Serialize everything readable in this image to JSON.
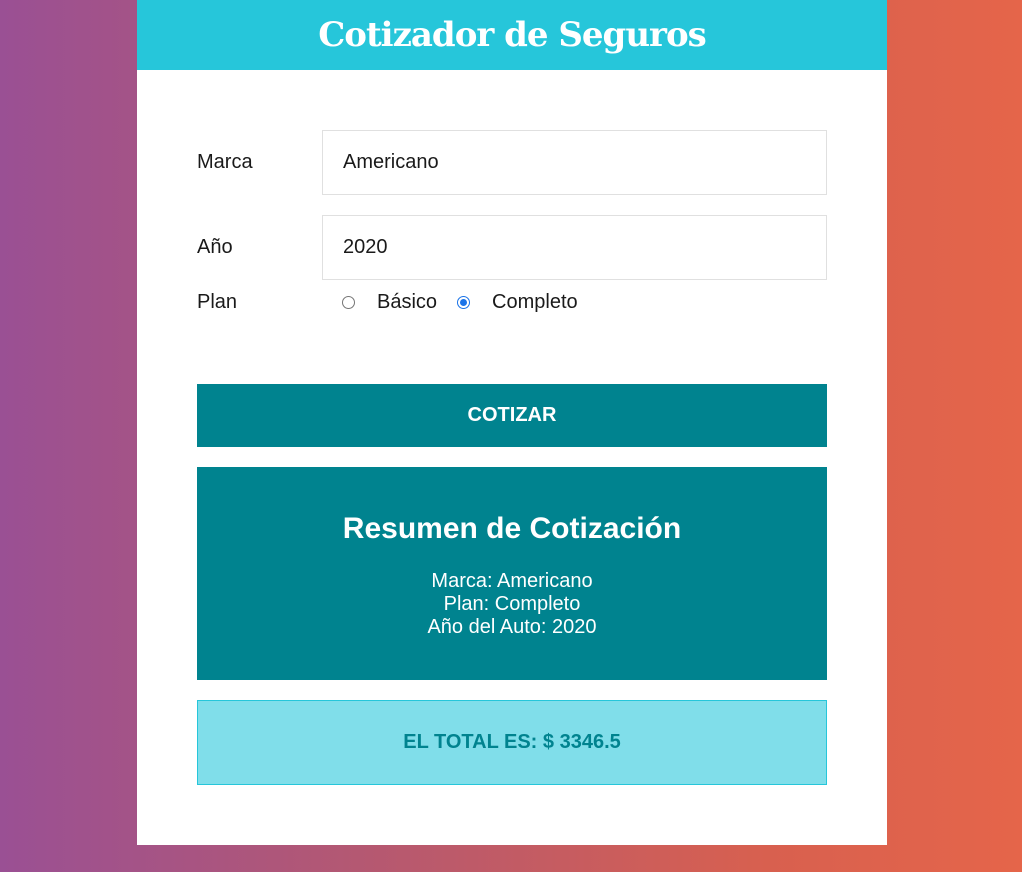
{
  "header": {
    "title": "Cotizador de Seguros"
  },
  "form": {
    "marca": {
      "label": "Marca",
      "value": "Americano"
    },
    "anio": {
      "label": "Año",
      "value": "2020"
    },
    "plan": {
      "label": "Plan",
      "options": [
        {
          "label": "Básico",
          "checked": false
        },
        {
          "label": "Completo",
          "checked": true
        }
      ]
    },
    "submit_label": "Cotizar"
  },
  "resumen": {
    "title": "Resumen de Cotización",
    "marca": "Marca: Americano",
    "plan": "Plan: Completo",
    "anio": "Año del Auto: 2020"
  },
  "total": {
    "text": "El total es: $ 3346.5"
  },
  "colors": {
    "header_bg": "#26c6da",
    "button_bg": "#00838f",
    "total_bg": "#80deea",
    "total_text": "#00838f",
    "radio_checked": "#1a73e8"
  }
}
